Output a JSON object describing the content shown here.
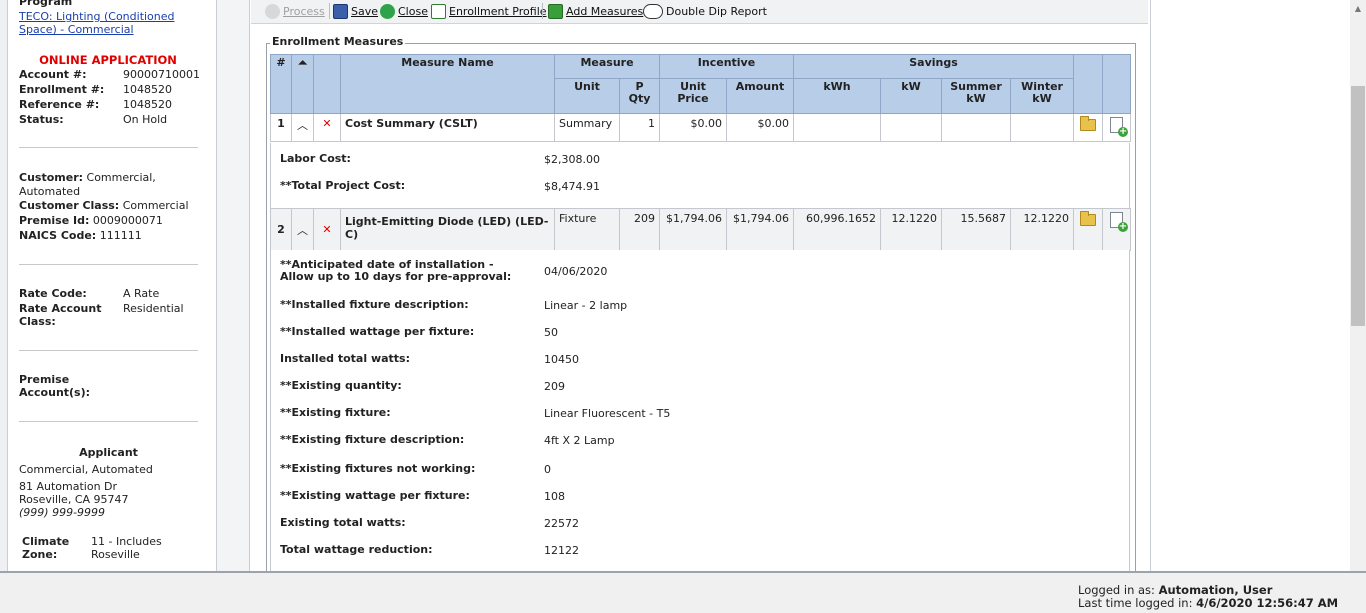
{
  "left": {
    "program_label": "Program",
    "program_link": "TECO: Lighting (Conditioned Space) - Commercial",
    "app_status_banner": "ONLINE APPLICATION",
    "account": {
      "label": "Account #:",
      "value": "90000710001"
    },
    "enrollment": {
      "label": "Enrollment #:",
      "value": "1048520"
    },
    "reference": {
      "label": "Reference #:",
      "value": "1048520"
    },
    "status": {
      "label": "Status:",
      "value": "On Hold"
    },
    "customer": {
      "label": "Customer:",
      "value": "Commercial, Automated"
    },
    "customer_class": {
      "label": "Customer Class:",
      "value": "Commercial"
    },
    "premise_id": {
      "label": "Premise Id:",
      "value": "0009000071"
    },
    "naics": {
      "label": "NAICS Code:",
      "value": "111111"
    },
    "rate_code": {
      "label": "Rate Code:",
      "value": "A Rate"
    },
    "rate_account_class": {
      "label": "Rate Account Class:",
      "value": "Residential"
    },
    "premise_accounts": {
      "label": "Premise Account(s):"
    },
    "applicant": {
      "title": "Applicant",
      "name": "Commercial, Automated",
      "address1": "81 Automation Dr",
      "address2": "Roseville, CA 95747",
      "phone": "(999) 999-9999"
    },
    "climate_zone": {
      "label": "Climate Zone:",
      "value": "11 - Includes Roseville"
    }
  },
  "toolbar": {
    "process": "Process",
    "save": "Save",
    "close": "Close",
    "enrollment_profile": "Enrollment Profile",
    "add_measures": "Add Measures",
    "double_dip": "Double Dip Report"
  },
  "section_title": "Enrollment Measures",
  "table": {
    "headers": {
      "num": "#",
      "measure_name": "Measure Name",
      "measure": "Measure",
      "incentive": "Incentive",
      "savings": "Savings",
      "unit": "Unit",
      "p_qty": "P Qty",
      "unit_price": "Unit Price",
      "amount": "Amount",
      "kwh": "kWh",
      "kw": "kW",
      "summer_kw": "Summer kW",
      "winter_kw": "Winter kW"
    },
    "rows": [
      {
        "num": "1",
        "name": "Cost Summary (CSLT)",
        "unit": "Summary",
        "qty": "1",
        "unit_price": "$0.00",
        "amount": "$0.00",
        "kwh": "",
        "kw": "",
        "summer_kw": "",
        "winter_kw": ""
      },
      {
        "num": "2",
        "name": "Light-Emitting Diode (LED) (LED-C)",
        "unit": "Fixture",
        "qty": "209",
        "unit_price": "$1,794.06",
        "amount": "$1,794.06",
        "kwh": "60,996.1652",
        "kw": "12.1220",
        "summer_kw": "15.5687",
        "winter_kw": "12.1220"
      }
    ]
  },
  "cost_summary": {
    "labor_cost": {
      "label": "Labor Cost:",
      "value": "$2,308.00"
    },
    "total_project_cost": {
      "label": "**Total Project Cost:",
      "value": "$8,474.91"
    }
  },
  "led_details": [
    {
      "label": "**Anticipated date of installation - Allow up to 10 days for pre-approval:",
      "value": "04/06/2020"
    },
    {
      "label": "**Installed fixture description:",
      "value": "Linear - 2 lamp"
    },
    {
      "label": "**Installed wattage per fixture:",
      "value": "50"
    },
    {
      "label": "Installed total watts:",
      "value": "10450"
    },
    {
      "label": "**Existing quantity:",
      "value": "209"
    },
    {
      "label": "**Existing fixture:",
      "value": "Linear Fluorescent - T5"
    },
    {
      "label": "**Existing fixture description:",
      "value": "4ft X 2 Lamp"
    },
    {
      "label": "**Existing fixtures not working:",
      "value": "0"
    },
    {
      "label": "**Existing wattage per fixture:",
      "value": "108"
    },
    {
      "label": "Existing total watts:",
      "value": "22572"
    },
    {
      "label": "Total wattage reduction:",
      "value": "12122"
    }
  ],
  "footer": {
    "logged_in_label": "Logged in as:",
    "logged_in_user": "Automation, User",
    "last_login_label": "Last time logged in:",
    "last_login_value": "4/6/2020 12:56:47 AM"
  },
  "colors": {
    "header_bg": "#b8cde8",
    "alert_red": "#e00000",
    "link_blue": "#1a3fae"
  }
}
